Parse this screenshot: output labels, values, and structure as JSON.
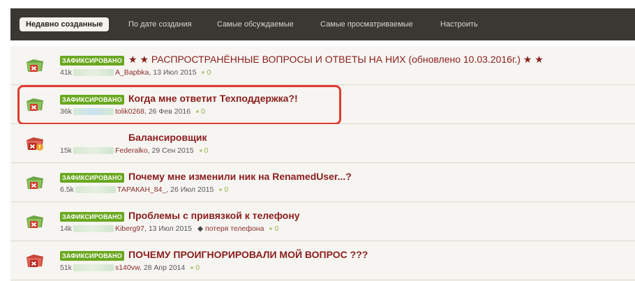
{
  "tabs": [
    {
      "label": "Недавно созданные",
      "active": true
    },
    {
      "label": "По дате создания"
    },
    {
      "label": "Самые обсуждаемые"
    },
    {
      "label": "Самые просматриваемые"
    },
    {
      "label": "Настроить"
    }
  ],
  "colors": {
    "badge": "#6aa81f",
    "title": "#8a1d1d",
    "highlight": "#e03a33",
    "tabbar": "#3a3833"
  },
  "topics": [
    {
      "badge": "ЗАФИКСИРОВАНО",
      "title": "★ ★ РАСПРОСТРАНЁННЫЕ ВОПРОСЫ И ОТВЕТЫ НА НИХ (обновлено 10.03.2016г.) ★ ★",
      "views": "41k",
      "author": "A_Bapbka",
      "date": "13 Июл 2015",
      "replies": "0",
      "icon": "locked-folder-icon"
    },
    {
      "badge": "ЗАФИКСИРОВАНО",
      "title": "Когда мне ответит Техподдержка?!",
      "views": "36k",
      "author": "tolik0268",
      "date": "26 Фев 2016",
      "replies": "0",
      "icon": "locked-folder-icon"
    },
    {
      "badge": "",
      "title": "Балансировщик",
      "views": "15k",
      "author": "Federalko",
      "date": "29 Сен 2015",
      "replies": "0",
      "icon": "locked-folder-alert-icon"
    },
    {
      "badge": "ЗАФИКСИРОВАНО",
      "title": "Почему мне изменили ник на RenamedUser...?",
      "views": "6.5k",
      "author": "ТАРАКАН_84_",
      "date": "26 Июл 2015",
      "replies": "0",
      "icon": "locked-folder-icon"
    },
    {
      "badge": "ЗАФИКСИРОВАНО",
      "title": "Проблемы с привязкой к телефону",
      "views": "14k",
      "author": "Kiberg97",
      "date": "13 Июл 2015",
      "tag": "потеря телефона",
      "replies": "0",
      "icon": "locked-folder-icon"
    },
    {
      "badge": "ЗАФИКСИРОВАНО",
      "title": "ПОЧЕМУ ПРОИГНОРИРОВАЛИ МОЙ ВОПРОС ???",
      "views": "51k",
      "author": "s140vw",
      "date": "28 Апр 2014",
      "replies": "0",
      "icon": "locked-folder-icon"
    }
  ]
}
